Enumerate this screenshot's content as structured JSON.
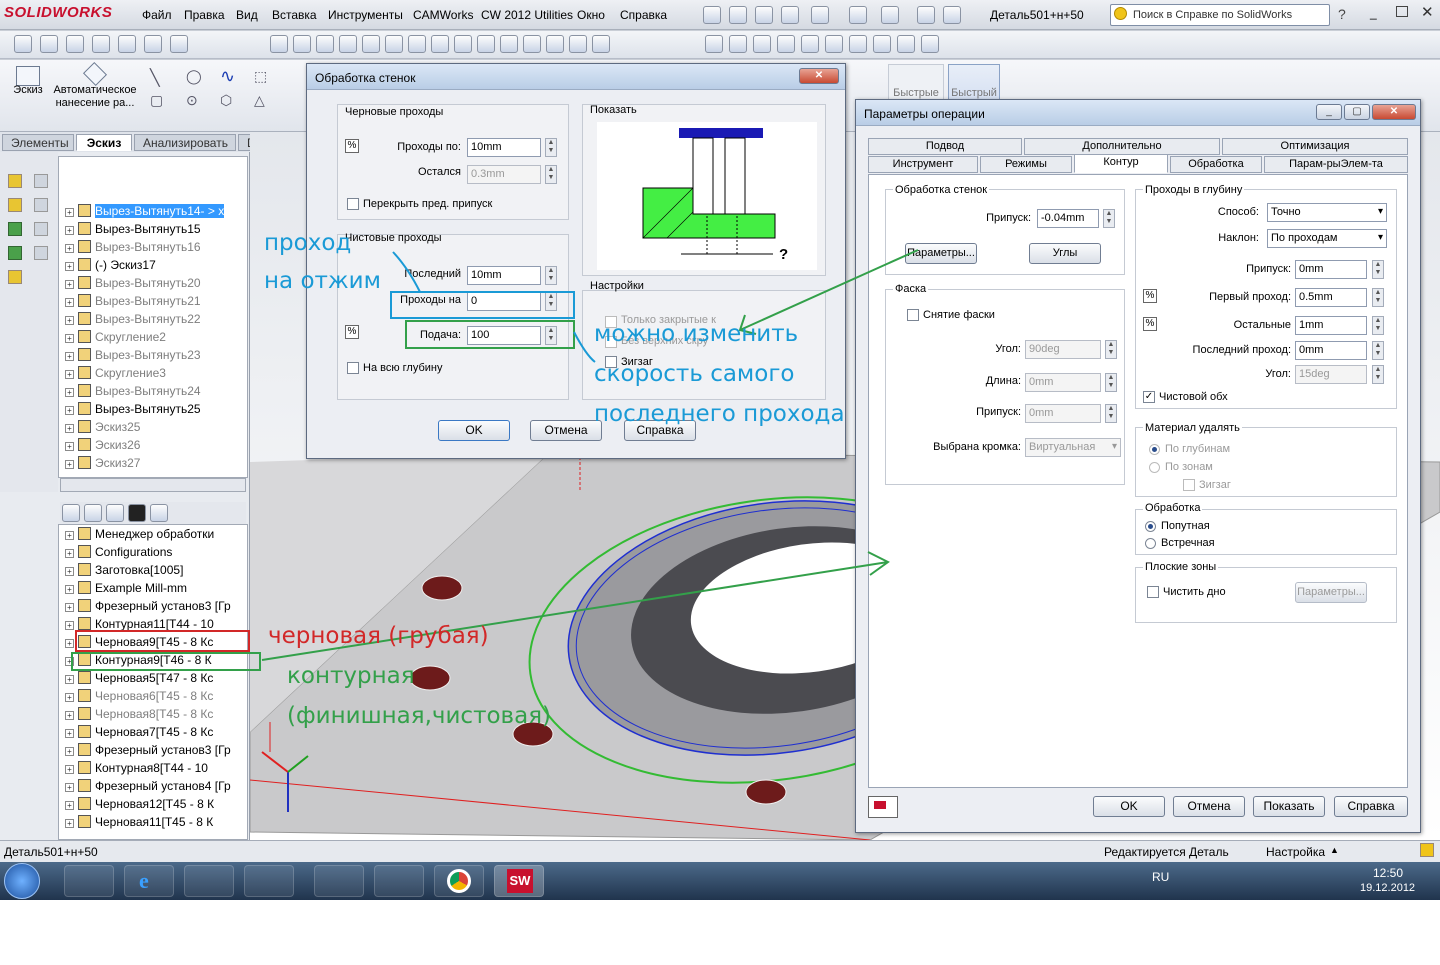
{
  "app": {
    "logo": "SOLIDWORKS",
    "document_title": "Деталь501+н+50"
  },
  "menu": [
    "Файл",
    "Правка",
    "Вид",
    "Вставка",
    "Инструменты",
    "CAMWorks",
    "CW 2012 Utilities",
    "Окно",
    "Справка"
  ],
  "help_search": {
    "placeholder": "Поиск в Справке по SolidWorks"
  },
  "command_manager": {
    "items": [
      {
        "label": "Эскиз"
      },
      {
        "label": "Автоматическое нанесение ра..."
      },
      {
        "label": "Быстрые"
      },
      {
        "label": "Быстрый"
      }
    ],
    "tabs": [
      "Элементы",
      "Эскиз",
      "Анализировать",
      "DimXpert"
    ],
    "active_tab": "Эскиз"
  },
  "feature_tree": [
    {
      "label": "Вырез-Вытянуть14- > х",
      "state": "selected"
    },
    {
      "label": "Вырез-Вытянуть15",
      "state": "normal"
    },
    {
      "label": "Вырез-Вытянуть16",
      "state": "gray"
    },
    {
      "label": "(-) Эскиз17",
      "state": "normal"
    },
    {
      "label": "Вырез-Вытянуть20",
      "state": "gray"
    },
    {
      "label": "Вырез-Вытянуть21",
      "state": "gray"
    },
    {
      "label": "Вырез-Вытянуть22",
      "state": "gray"
    },
    {
      "label": "Скругление2",
      "state": "gray"
    },
    {
      "label": "Вырез-Вытянуть23",
      "state": "gray"
    },
    {
      "label": "Скругление3",
      "state": "gray"
    },
    {
      "label": "Вырез-Вытянуть24",
      "state": "gray"
    },
    {
      "label": "Вырез-Вытянуть25",
      "state": "normal"
    },
    {
      "label": "Эскиз25",
      "state": "gray"
    },
    {
      "label": "Эскиз26",
      "state": "gray"
    },
    {
      "label": "Эскиз27",
      "state": "gray"
    }
  ],
  "cam_tree": [
    {
      "label": "Менеджер обработки",
      "state": "normal"
    },
    {
      "label": "Configurations",
      "state": "normal"
    },
    {
      "label": "Заготовка[1005]",
      "state": "normal"
    },
    {
      "label": "Example Mill-mm",
      "state": "normal"
    },
    {
      "label": "Фрезерный установ3 [Гр",
      "state": "normal"
    },
    {
      "label": "Контурная11[T44 - 10",
      "state": "normal"
    },
    {
      "label": "Черновая9[T45 - 8 Кс",
      "state": "normal"
    },
    {
      "label": "Контурная9[T46 - 8 К",
      "state": "normal"
    },
    {
      "label": "Черновая5[T47 - 8 Кс",
      "state": "normal"
    },
    {
      "label": "Черновая6[T45 - 8 Кс",
      "state": "gray"
    },
    {
      "label": "Черновая8[T45 - 8 Кс",
      "state": "gray"
    },
    {
      "label": "Черновая7[T45 - 8 Кс",
      "state": "normal"
    },
    {
      "label": "Фрезерный установ3 [Гр",
      "state": "normal"
    },
    {
      "label": "Контурная8[T44 - 10",
      "state": "normal"
    },
    {
      "label": "Фрезерный установ4 [Гр",
      "state": "normal"
    },
    {
      "label": "Черновая12[T45 - 8 К",
      "state": "normal"
    },
    {
      "label": "Черновая11[T45 - 8 К",
      "state": "normal"
    }
  ],
  "status": {
    "doc": "Деталь501+н+50",
    "editing": "Редактируется Деталь",
    "settings": "Настройка"
  },
  "taskbar": {
    "lang": "RU",
    "time": "12:50",
    "date": "19.12.2012"
  },
  "wall_dialog": {
    "title": "Обработка стенок",
    "rough_group": "Черновые проходы",
    "passes_label": "Проходы по:",
    "passes_value": "10mm",
    "remain_label": "Остался",
    "remain_value": "0.3mm",
    "overlap_label": "Перекрыть пред. припуск",
    "finish_group": "Чистовые проходы",
    "last_label": "Последний",
    "last_value": "10mm",
    "passes_on_label": "Проходы на",
    "passes_on_value": "0",
    "feed_label": "Подача:",
    "feed_value": "100",
    "full_depth_label": "На всю глубину",
    "show_group": "Показать",
    "settings_group": "Настройки",
    "closed_only": "Только закрытые к",
    "no_top": "Без верхних скру",
    "zigzag": "Зигзаг",
    "ok": "OK",
    "cancel": "Отмена",
    "help": "Справка"
  },
  "op_dialog": {
    "title": "Параметры операции",
    "tabs_row1": [
      "Подвод",
      "Дополнительно",
      "Оптимизация"
    ],
    "tabs_row2": [
      "Инструмент",
      "Режимы",
      "Контур",
      "Обработка",
      "Парам-рыЭлем-та"
    ],
    "active_tab": "Контур",
    "wall": {
      "group": "Обработка стенок",
      "allowance_label": "Припуск:",
      "allowance_value": "-0.04mm",
      "params_button": "Параметры...",
      "angles_button": "Углы"
    },
    "chamfer": {
      "group": "Фаска",
      "remove_label": "Снятие фаски",
      "angle_label": "Угол:",
      "angle_value": "90deg",
      "length_label": "Длина:",
      "length_value": "0mm",
      "allowance_label": "Припуск:",
      "allowance_value": "0mm",
      "edge_label": "Выбрана кромка:",
      "edge_value": "Виртуальная"
    },
    "depth": {
      "group": "Проходы в глубину",
      "method_label": "Способ:",
      "method_value": "Точно",
      "slope_label": "Наклон:",
      "slope_value": "По проходам",
      "allowance_label": "Припуск:",
      "allowance_value": "0mm",
      "first_label": "Первый проход:",
      "first_value": "0.5mm",
      "rest_label": "Остальные",
      "rest_value": "1mm",
      "last_label": "Последний проход:",
      "last_value": "0mm",
      "angle_label": "Угол:",
      "angle_value": "15deg",
      "finish_label": "Чистовой обх"
    },
    "material": {
      "group": "Материал удалять",
      "by_depth": "По глубинам",
      "by_zone": "По зонам",
      "zigzag": "Зигзаг"
    },
    "machining": {
      "group": "Обработка",
      "climb": "Попутная",
      "conventional": "Встречная"
    },
    "flat": {
      "group": "Плоские зоны",
      "clean_bottom": "Чистить дно",
      "params_button": "Параметры..."
    },
    "ok": "OK",
    "cancel": "Отмена",
    "show": "Показать",
    "help": "Справка"
  },
  "annotations": {
    "pass_offset": "проход\nна отжим",
    "change_speed": "можно изменить\nскорость самого\nпоследнего прохода",
    "rough": "черновая (грубая)",
    "contour": "контурная\n(финишная,чистовая)"
  }
}
